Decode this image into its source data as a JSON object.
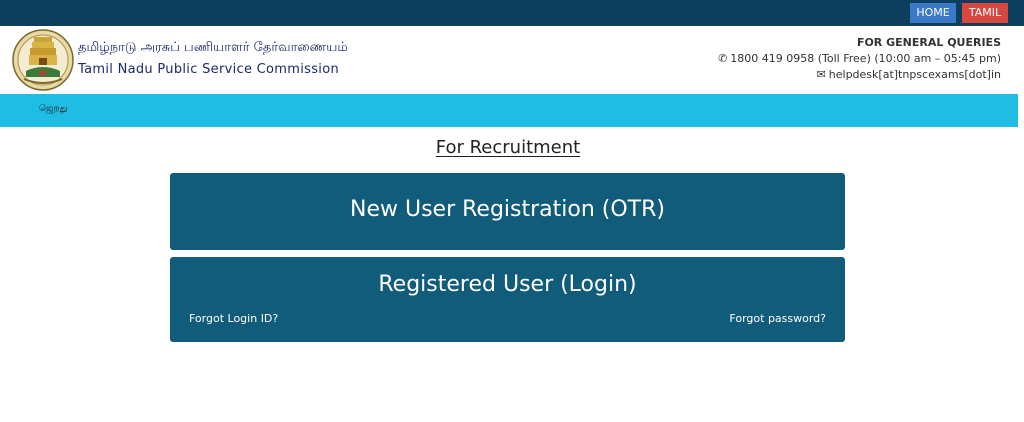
{
  "topbar": {
    "home_label": "HOME",
    "tamil_label": "TAMIL"
  },
  "header": {
    "title_tamil": "தமிழ்நாடு அரசுப் பணியாளர் தேர்வாணையம்",
    "title_english": "Tamil Nadu Public Service Commission",
    "queries_heading": "FOR GENERAL QUERIES",
    "phone": "1800 419 0958 (Toll Free) (10:00 am – 05:45 pm)",
    "email": "helpdesk[at]tnpscexams[dot]in"
  },
  "navbar": {
    "item": "ஜெறது"
  },
  "main": {
    "section_title": "For Recruitment",
    "register_label": "New User Registration (OTR)",
    "login_label": "Registered User (Login)",
    "forgot_login": "Forgot Login ID?",
    "forgot_password": "Forgot password?"
  },
  "colors": {
    "topbar": "#0d3f5d",
    "navbar": "#1fbde4",
    "card": "#125c7b",
    "home_button": "#3a79c6",
    "tamil_button": "#d7473f"
  }
}
